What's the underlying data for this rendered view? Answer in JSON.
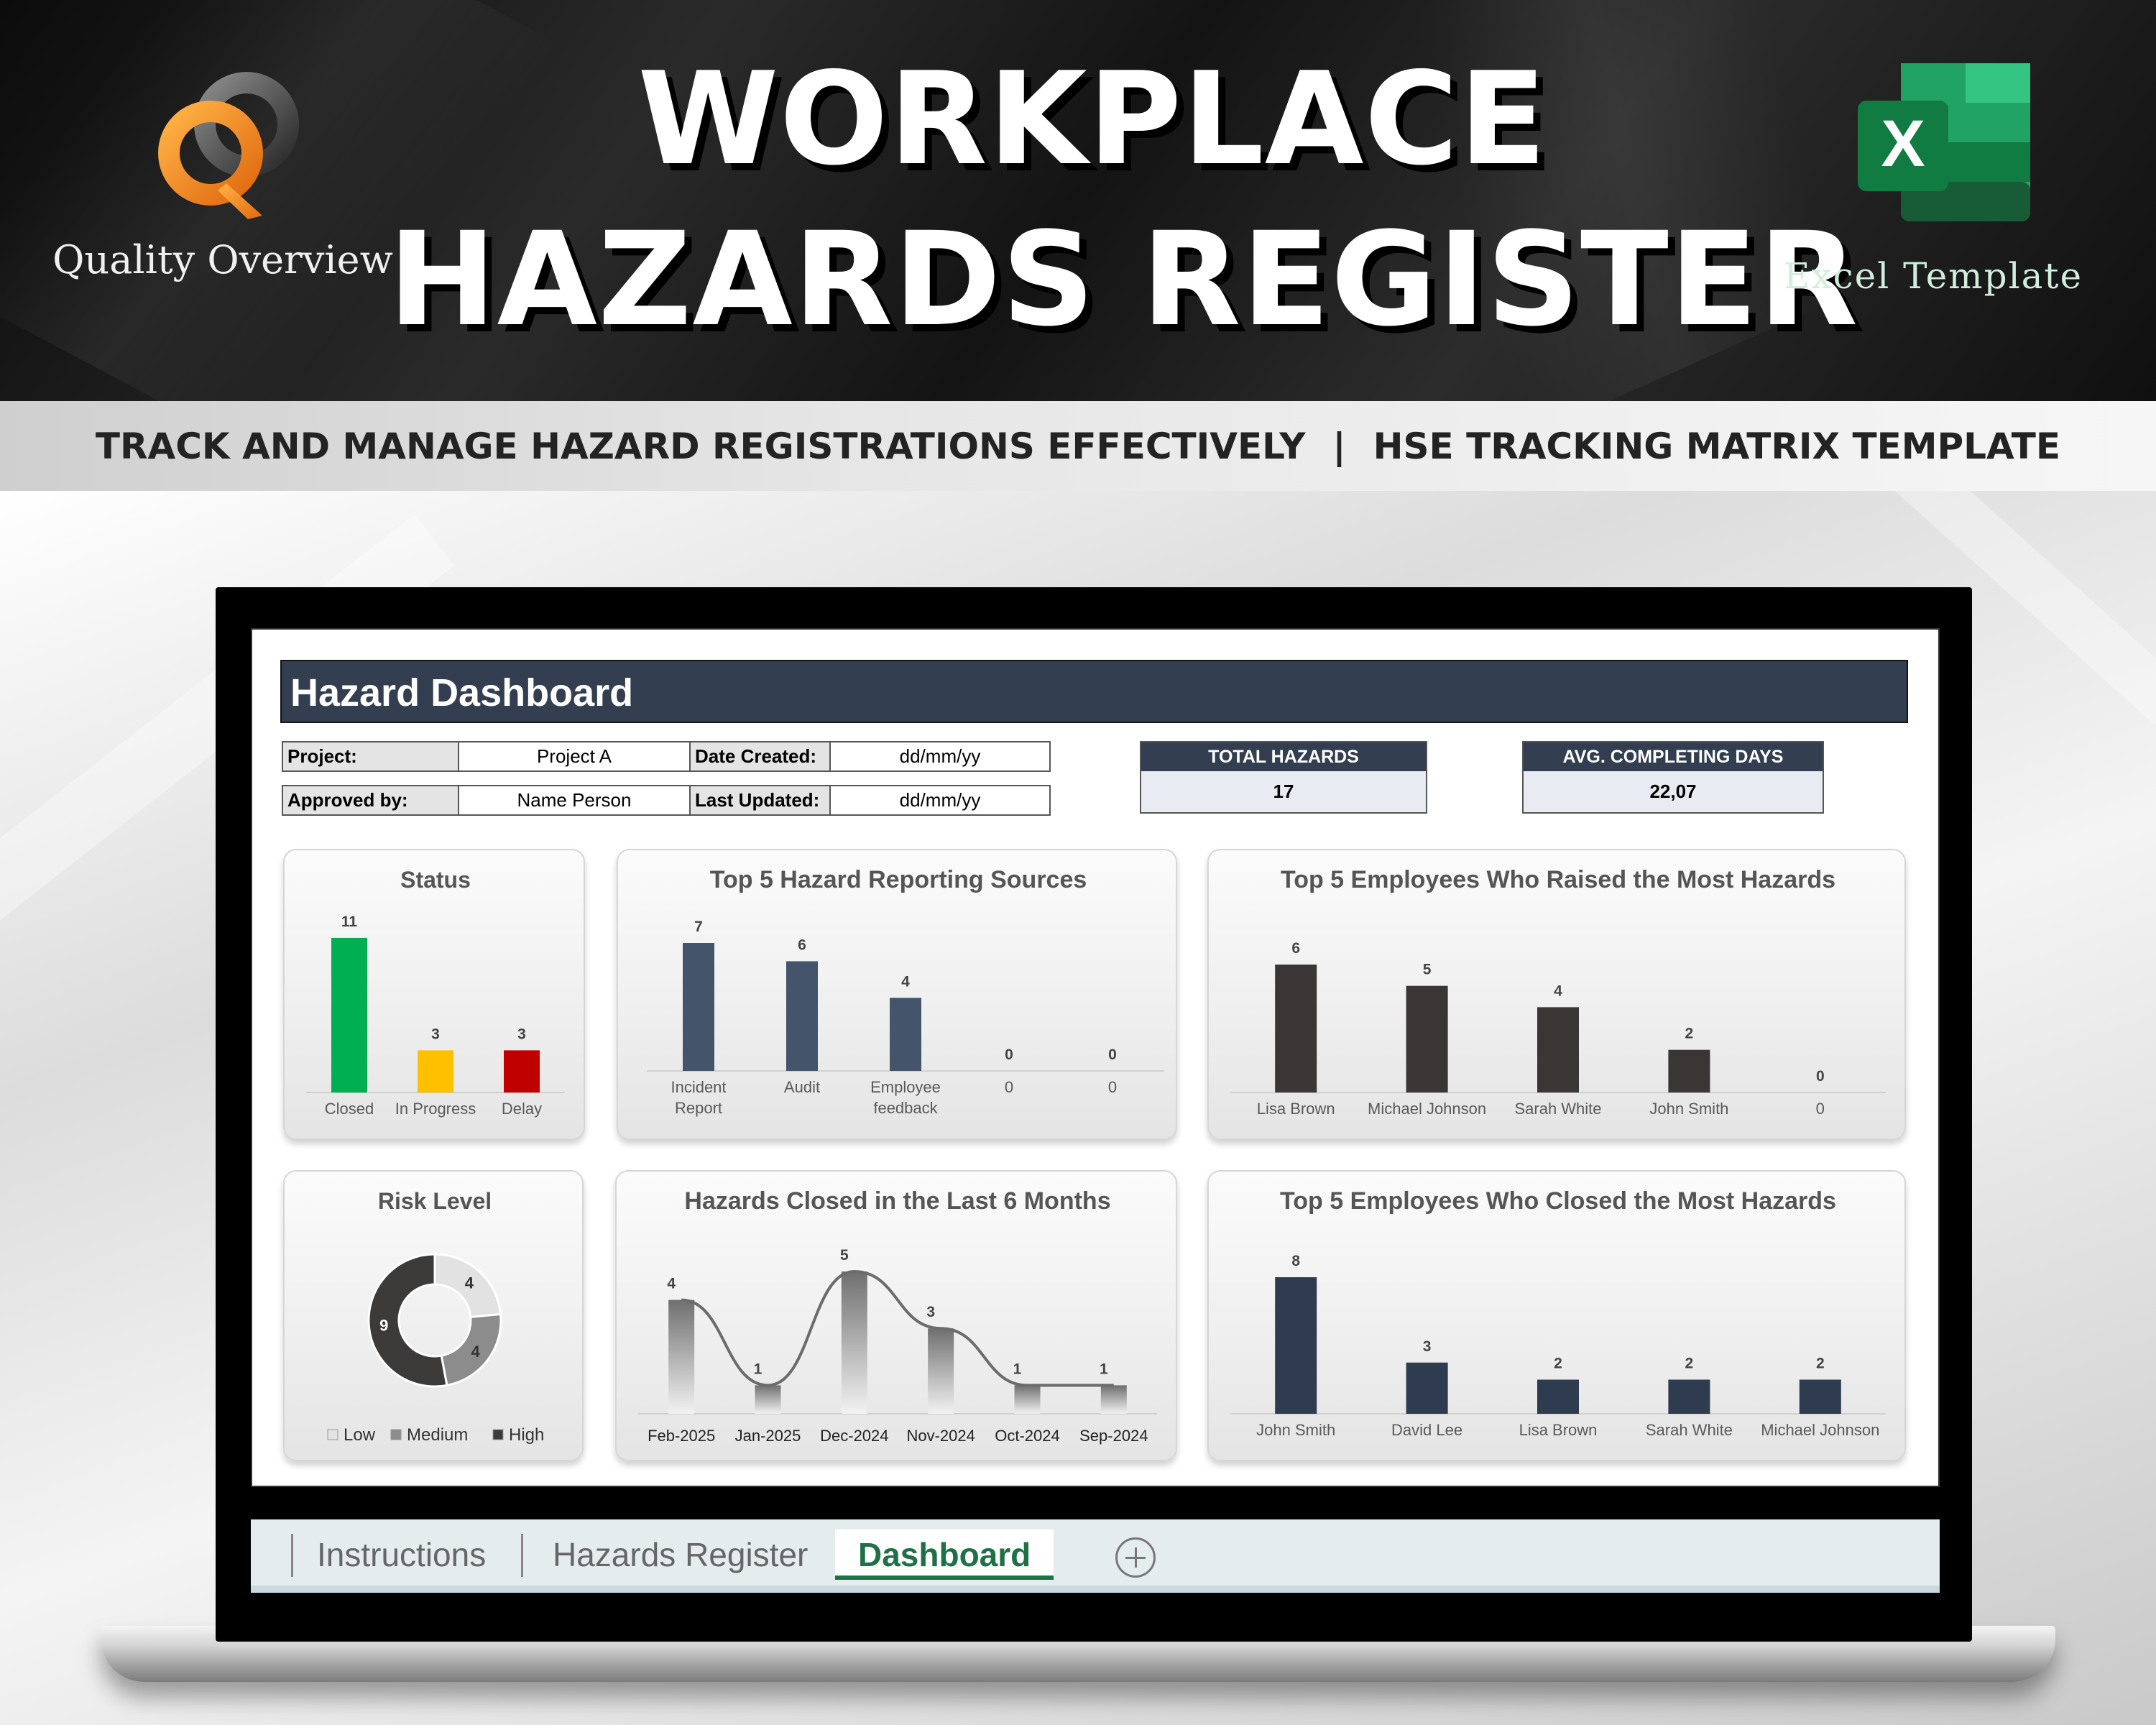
{
  "banner": {
    "title_line1": "WORKPLACE",
    "title_line2": "HAZARDS REGISTER",
    "brand_name": "Quality Overview",
    "logo_icon": "QO-logo",
    "excel_icon": "excel-icon",
    "excel_label": "Excel Template"
  },
  "subtitle": {
    "left": "TRACK AND MANAGE HAZARD REGISTRATIONS EFFECTIVELY",
    "separator": "|",
    "right": "HSE TRACKING MATRIX TEMPLATE"
  },
  "dashboard": {
    "title": "Hazard Dashboard",
    "info": {
      "project_label": "Project:",
      "project_value": "Project A",
      "date_created_label": "Date Created:",
      "date_created_value": "dd/mm/yy",
      "approved_label": "Approved by:",
      "approved_value": "Name Person",
      "last_updated_label": "Last Updated:",
      "last_updated_value": "dd/mm/yy"
    },
    "kpis": {
      "total_label": "TOTAL HAZARDS",
      "total_value": "17",
      "avg_label": "AVG. COMPLETING DAYS",
      "avg_value": "22,07"
    }
  },
  "colors": {
    "header_navy": "#333f50",
    "status_closed": "#00b050",
    "status_in_progress": "#ffc000",
    "status_delay": "#c00000",
    "bar_navy": "#44546a",
    "bar_dark": "#3a3636",
    "excel_green": "#1e7145"
  },
  "chart_data": [
    {
      "id": "status",
      "type": "bar",
      "title": "Status",
      "categories": [
        "Closed",
        "In Progress",
        "Delay"
      ],
      "values": [
        11,
        3,
        3
      ],
      "colors": [
        "#00b050",
        "#ffc000",
        "#c00000"
      ],
      "ylim": [
        0,
        11
      ]
    },
    {
      "id": "sources",
      "type": "bar",
      "title": "Top 5 Hazard Reporting Sources",
      "categories": [
        [
          "Incident",
          "Report"
        ],
        [
          "Audit"
        ],
        [
          "Employee",
          "feedback"
        ],
        [
          "0"
        ],
        [
          "0"
        ]
      ],
      "values": [
        7,
        6,
        4,
        0,
        0
      ],
      "ylim": [
        0,
        7
      ]
    },
    {
      "id": "raised",
      "type": "bar",
      "title": "Top 5 Employees Who Raised the Most Hazards",
      "categories": [
        "Lisa Brown",
        "Michael Johnson",
        "Sarah White",
        "John Smith",
        "0"
      ],
      "values": [
        6,
        5,
        4,
        2,
        0
      ],
      "ylim": [
        0,
        6
      ]
    },
    {
      "id": "risk",
      "type": "pie",
      "title": "Risk Level",
      "labels": [
        "Low",
        "Medium",
        "High"
      ],
      "values": [
        4,
        4,
        9
      ],
      "colors": [
        "#e2e2e2",
        "#8c8c8c",
        "#3d3a3a"
      ],
      "legend": "bottom"
    },
    {
      "id": "closed6",
      "type": "bar",
      "title": "Hazards Closed in the Last 6 Months",
      "categories": [
        "Feb-2025",
        "Jan-2025",
        "Dec-2024",
        "Nov-2024",
        "Oct-2024",
        "Sep-2024"
      ],
      "values": [
        4,
        1,
        5,
        3,
        1,
        1
      ],
      "trendline": "smooth",
      "ylim": [
        0,
        5
      ]
    },
    {
      "id": "closedby",
      "type": "bar",
      "title": "Top 5 Employees Who Closed the Most Hazards",
      "categories": [
        "John Smith",
        "David Lee",
        "Lisa Brown",
        "Sarah White",
        "Michael Johnson"
      ],
      "values": [
        8,
        3,
        2,
        2,
        2
      ],
      "ylim": [
        0,
        8
      ]
    }
  ],
  "tabs": [
    {
      "label": "Instructions",
      "active": false
    },
    {
      "label": "Hazards Register",
      "active": false
    },
    {
      "label": "Dashboard",
      "active": true
    }
  ],
  "add_sheet_icon": "plus-circle-icon"
}
